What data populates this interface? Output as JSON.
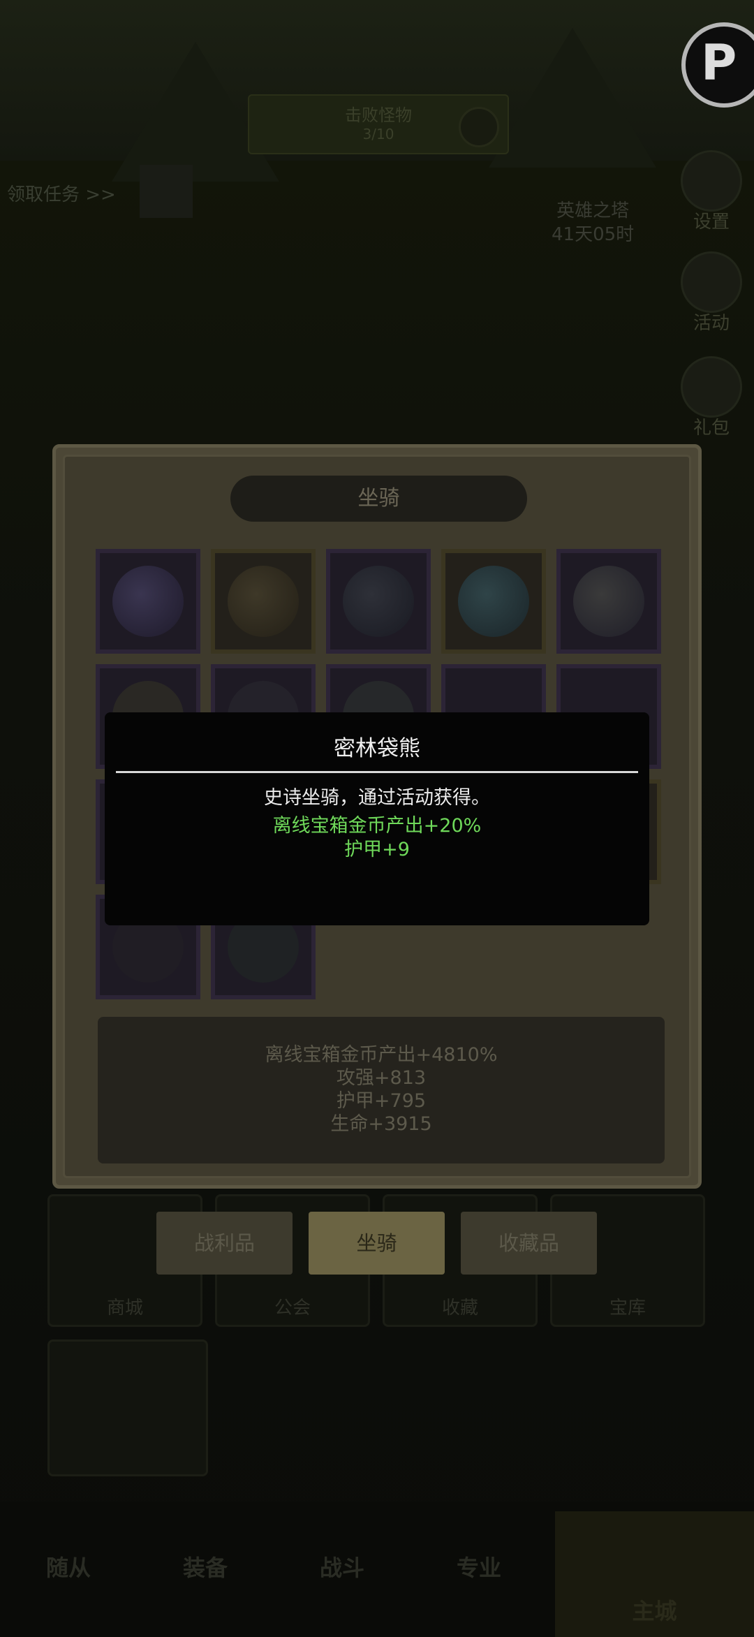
{
  "background": {
    "banner_title": "击败怪物",
    "banner_sub": "3/10",
    "quest_link": "领取任务 >>",
    "timer_title": "英雄之塔",
    "timer_value": "41天05时",
    "side_menu": [
      "设置",
      "活动",
      "礼包"
    ]
  },
  "panel": {
    "title": "坐骑",
    "stats": [
      "离线宝箱金币产出+4810%",
      "攻强+813",
      "护甲+795",
      "生命+3915"
    ]
  },
  "tooltip": {
    "name": "密林袋熊",
    "description": "史诗坐骑，通过活动获得。",
    "attributes": [
      "离线宝箱金币产出+20%",
      "护甲+9"
    ],
    "attribute_color": "#6fd95a"
  },
  "category_tabs": [
    {
      "label": "战利品",
      "active": false
    },
    {
      "label": "坐骑",
      "active": true
    },
    {
      "label": "收藏品",
      "active": false
    }
  ],
  "under_menu": [
    "商城",
    "公会",
    "收藏",
    "宝库"
  ],
  "bottom_nav": [
    "随从",
    "装备",
    "战斗",
    "专业",
    "主城"
  ],
  "colors": {
    "overlay": "#0d0e0a",
    "panel": "#4c4736",
    "epic_frame": "#2c2436",
    "legendary_frame": "#3a3520"
  }
}
